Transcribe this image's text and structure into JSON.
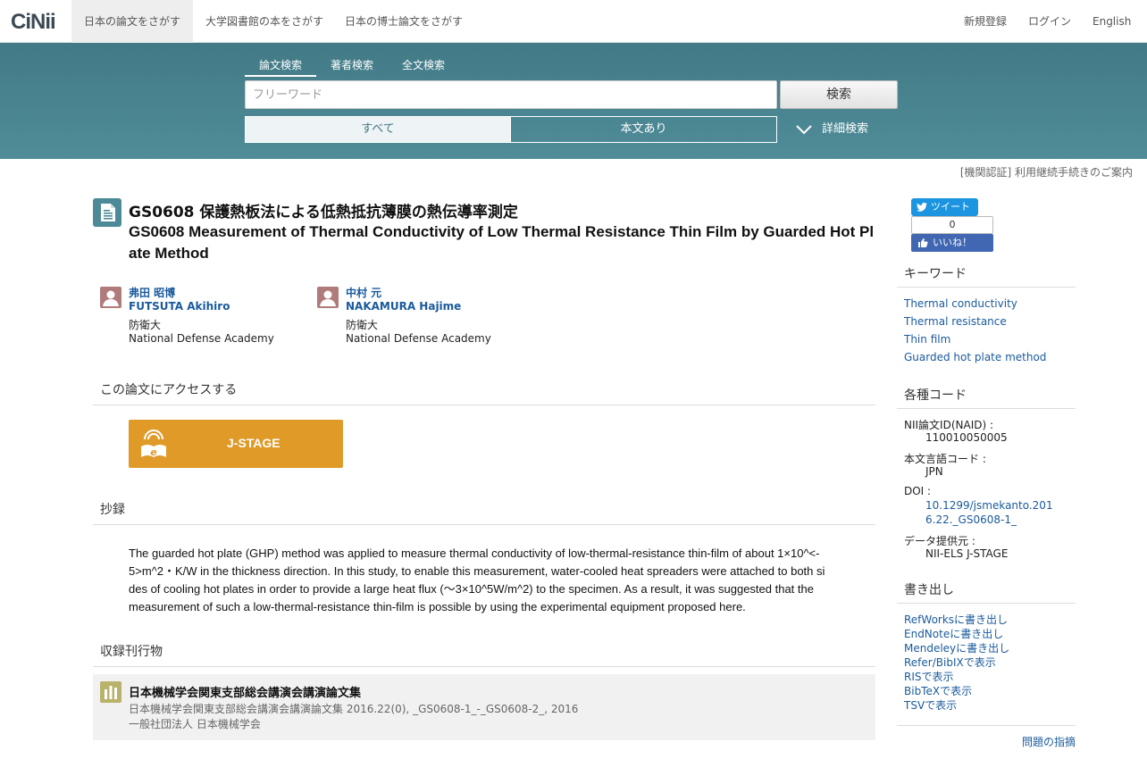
{
  "header": {
    "logo": "CiNii",
    "tabs": [
      {
        "label": "日本の論文をさがす"
      },
      {
        "label": "大学図書館の本をさがす"
      },
      {
        "label": "日本の博士論文をさがす"
      }
    ],
    "register": "新規登録",
    "login": "ログイン",
    "language": "English"
  },
  "search": {
    "tabs": [
      {
        "label": "論文検索"
      },
      {
        "label": "著者検索"
      },
      {
        "label": "全文検索"
      }
    ],
    "placeholder": "フリーワード",
    "value": "",
    "button": "検索",
    "filter_all": "すべて",
    "filter_fulltext": "本文あり",
    "advanced": "詳細検索"
  },
  "institution_notice": "[機関認証] 利用継続手続きのご案内",
  "paper": {
    "title_ja": "GS0608 保護熱板法による低熱抵抗薄膜の熱伝導率測定",
    "title_en": "GS0608 Measurement of Thermal Conductivity of Low Thermal Resistance Thin Film by Guarded Hot Plate Method",
    "authors": [
      {
        "name_ja": "弗田 昭博",
        "name_en": "FUTSUTA Akihiro",
        "aff_ja": "防衛大",
        "aff_en": "National Defense Academy"
      },
      {
        "name_ja": "中村 元",
        "name_en": "NAKAMURA Hajime",
        "aff_ja": "防衛大",
        "aff_en": "National Defense Academy"
      }
    ]
  },
  "access": {
    "heading": "この論文にアクセスする",
    "jstage_label": "J-STAGE"
  },
  "abstract": {
    "heading": "抄録",
    "text": "The guarded hot plate (GHP) method was applied to measure thermal conductivity of low-thermal-resistance thin-film of about 1×10^<-5>m^2・K/W in the thickness direction. In this study, to enable this measurement, water-cooled heat spreaders were attached to both sides of cooling hot plates in order to provide a large heat flux (〜3×10^5W/m^2) to the specimen. As a result, it was suggested that the measurement of such a low-thermal-resistance thin-film is possible by using the experimental equipment proposed here."
  },
  "journal": {
    "heading": "収録刊行物",
    "title": "日本機械学会関東支部総会講演会講演論文集",
    "citation": "日本機械学会関東支部総会講演会講演論文集 2016.22(0), _GS0608-1_-_GS0608-2_, 2016",
    "publisher": "一般社団法人 日本機械学会"
  },
  "social": {
    "tweet": "ツイート",
    "like_count": "0",
    "like": "いいね！"
  },
  "keywords": {
    "heading": "キーワード",
    "items": [
      "Thermal conductivity",
      "Thermal resistance",
      "Thin film",
      "Guarded hot plate method"
    ]
  },
  "codes": {
    "heading": "各種コード",
    "naid_label": "NII論文ID(NAID) :",
    "naid": "110010050005",
    "lang_label": "本文言語コード :",
    "lang": "JPN",
    "doi_label": "DOI :",
    "doi": "10.1299/jsmekanto.2016.22._GS0608-1_",
    "provider_label": "データ提供元 :",
    "provider": "NII-ELS  J-STAGE"
  },
  "export": {
    "heading": "書き出し",
    "items": [
      "RefWorksに書き出し",
      "EndNoteに書き出し",
      "Mendeleyに書き出し",
      "Refer/BibIXで表示",
      "RISで表示",
      "BibTeXで表示",
      "TSVで表示"
    ]
  },
  "report": "問題の指摘",
  "colors": {
    "band": "#4a8591",
    "jstage": "#df9a27",
    "link": "#1a5a9c"
  }
}
